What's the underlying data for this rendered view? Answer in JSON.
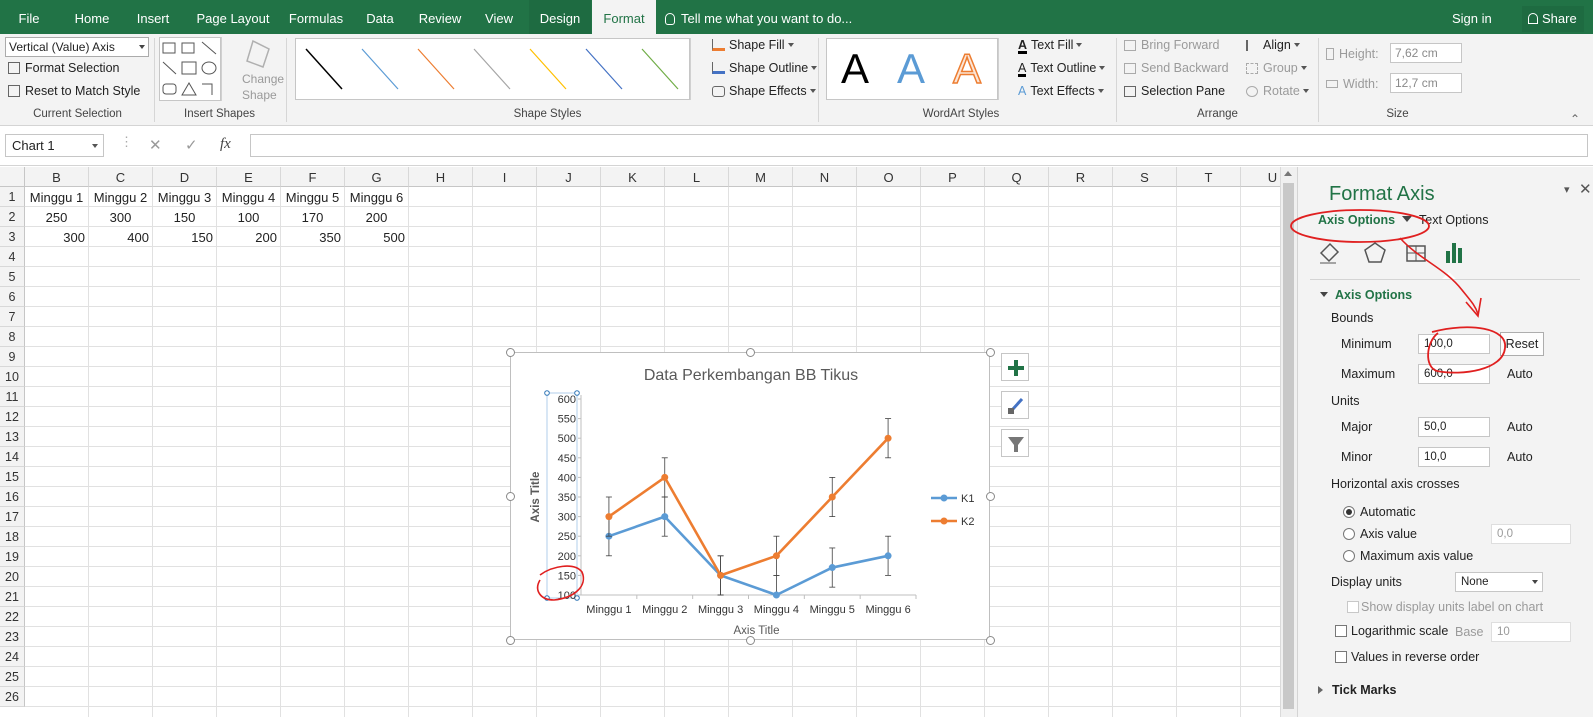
{
  "tabs": {
    "file": "File",
    "home": "Home",
    "insert": "Insert",
    "page_layout": "Page Layout",
    "formulas": "Formulas",
    "data": "Data",
    "review": "Review",
    "view": "View",
    "design": "Design",
    "format": "Format",
    "tell_me": "Tell me what you want to do...",
    "sign_in": "Sign in",
    "share": "Share"
  },
  "ribbon": {
    "current_selection": {
      "element_select": "Vertical (Value) Axis",
      "format_selection": "Format Selection",
      "reset_style": "Reset to Match Style",
      "label": "Current Selection"
    },
    "insert_shapes": {
      "change_shape_1": "Change",
      "change_shape_2": "Shape",
      "label": "Insert Shapes"
    },
    "shape_styles": {
      "line_colors": [
        "#000000",
        "#5b9bd5",
        "#ed7d31",
        "#a5a5a5",
        "#ffc000",
        "#4472c4",
        "#70ad47"
      ],
      "shape_fill": "Shape Fill",
      "shape_outline": "Shape Outline",
      "shape_effects": "Shape Effects",
      "label": "Shape Styles"
    },
    "wordart": {
      "letter": "A",
      "text_fill": "Text Fill",
      "text_outline": "Text Outline",
      "text_effects": "Text Effects",
      "label": "WordArt Styles"
    },
    "arrange": {
      "bring_forward": "Bring Forward",
      "send_backward": "Send Backward",
      "selection_pane": "Selection Pane",
      "align": "Align",
      "group": "Group",
      "rotate": "Rotate",
      "label": "Arrange"
    },
    "size": {
      "height_label": "Height:",
      "height_value": "7,62 cm",
      "width_label": "Width:",
      "width_value": "12,7 cm",
      "label": "Size"
    }
  },
  "formula_bar": {
    "name_box": "Chart 1",
    "fx": "fx",
    "cancel": "✕",
    "enter": "✓"
  },
  "sheet": {
    "columns": [
      "B",
      "C",
      "D",
      "E",
      "F",
      "G",
      "H",
      "I",
      "J",
      "K",
      "L",
      "M",
      "N",
      "O",
      "P",
      "Q",
      "R",
      "S",
      "T",
      "U"
    ],
    "rows": [
      "1",
      "2",
      "3",
      "4",
      "5",
      "6",
      "7",
      "8",
      "9",
      "10",
      "11",
      "12",
      "13",
      "14",
      "15",
      "16",
      "17",
      "18",
      "19",
      "20",
      "21",
      "22",
      "23",
      "24",
      "25",
      "26"
    ],
    "row1": [
      "Minggu 1",
      "Minggu 2",
      "Minggu 3",
      "Minggu 4",
      "Minggu 5",
      "Minggu 6"
    ],
    "row2": [
      "250",
      "300",
      "150",
      "100",
      "170",
      "200"
    ],
    "row3": [
      "300",
      "400",
      "150",
      "200",
      "350",
      "500"
    ]
  },
  "chart_data": {
    "type": "line",
    "title": "Data Perkembangan BB Tikus",
    "xlabel": "Axis Title",
    "ylabel": "Axis Title",
    "categories": [
      "Minggu 1",
      "Minggu 2",
      "Minggu 3",
      "Minggu 4",
      "Minggu 5",
      "Minggu 6"
    ],
    "y_ticks": [
      "600",
      "550",
      "500",
      "450",
      "400",
      "350",
      "300",
      "250",
      "200",
      "150",
      "100"
    ],
    "ylim": [
      100,
      600
    ],
    "series": [
      {
        "name": "K1",
        "values": [
          250,
          300,
          150,
          100,
          170,
          200
        ],
        "color": "#5b9bd5"
      },
      {
        "name": "K2",
        "values": [
          300,
          400,
          150,
          200,
          350,
          500
        ],
        "color": "#ed7d31"
      }
    ],
    "error_bars": 50,
    "legend": "right",
    "grid": false
  },
  "pane": {
    "title": "Format Axis",
    "tab_axis_options": "Axis Options",
    "tab_text_options": "Text Options",
    "section": "Axis Options",
    "bounds": "Bounds",
    "minimum": "Minimum",
    "minimum_value": "100,0",
    "reset": "Reset",
    "maximum": "Maximum",
    "maximum_value": "600,0",
    "auto": "Auto",
    "units": "Units",
    "major": "Major",
    "major_value": "50,0",
    "minor": "Minor",
    "minor_value": "10,0",
    "horizontal_crosses": "Horizontal axis crosses",
    "automatic": "Automatic",
    "axis_value": "Axis value",
    "axis_value_input": "0,0",
    "max_axis_value": "Maximum axis value",
    "display_units": "Display units",
    "display_units_value": "None",
    "show_units_label": "Show display units label on chart",
    "log_scale": "Logarithmic scale",
    "base_label": "Base",
    "base_value": "10",
    "reverse": "Values in reverse order",
    "tick_marks": "Tick Marks"
  },
  "colors": {
    "excel_green": "#217346",
    "annotation": "#e02020"
  }
}
